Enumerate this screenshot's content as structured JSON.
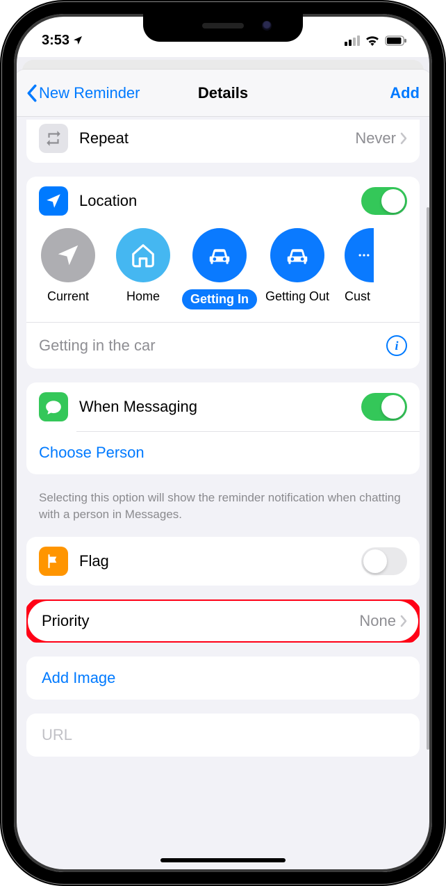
{
  "status": {
    "time": "3:53"
  },
  "nav": {
    "back": "New Reminder",
    "title": "Details",
    "action": "Add"
  },
  "repeat": {
    "label": "Repeat",
    "value": "Never"
  },
  "location": {
    "label": "Location",
    "chips": {
      "current": "Current",
      "home": "Home",
      "getting_in": "Getting In",
      "getting_out": "Getting Out",
      "custom": "Cust"
    },
    "detail": "Getting in the car"
  },
  "messaging": {
    "label": "When Messaging",
    "choose": "Choose Person",
    "footer": "Selecting this option will show the reminder notification when chatting with a person in Messages."
  },
  "flag": {
    "label": "Flag"
  },
  "priority": {
    "label": "Priority",
    "value": "None"
  },
  "add_image": {
    "label": "Add Image"
  },
  "url": {
    "placeholder": "URL"
  }
}
